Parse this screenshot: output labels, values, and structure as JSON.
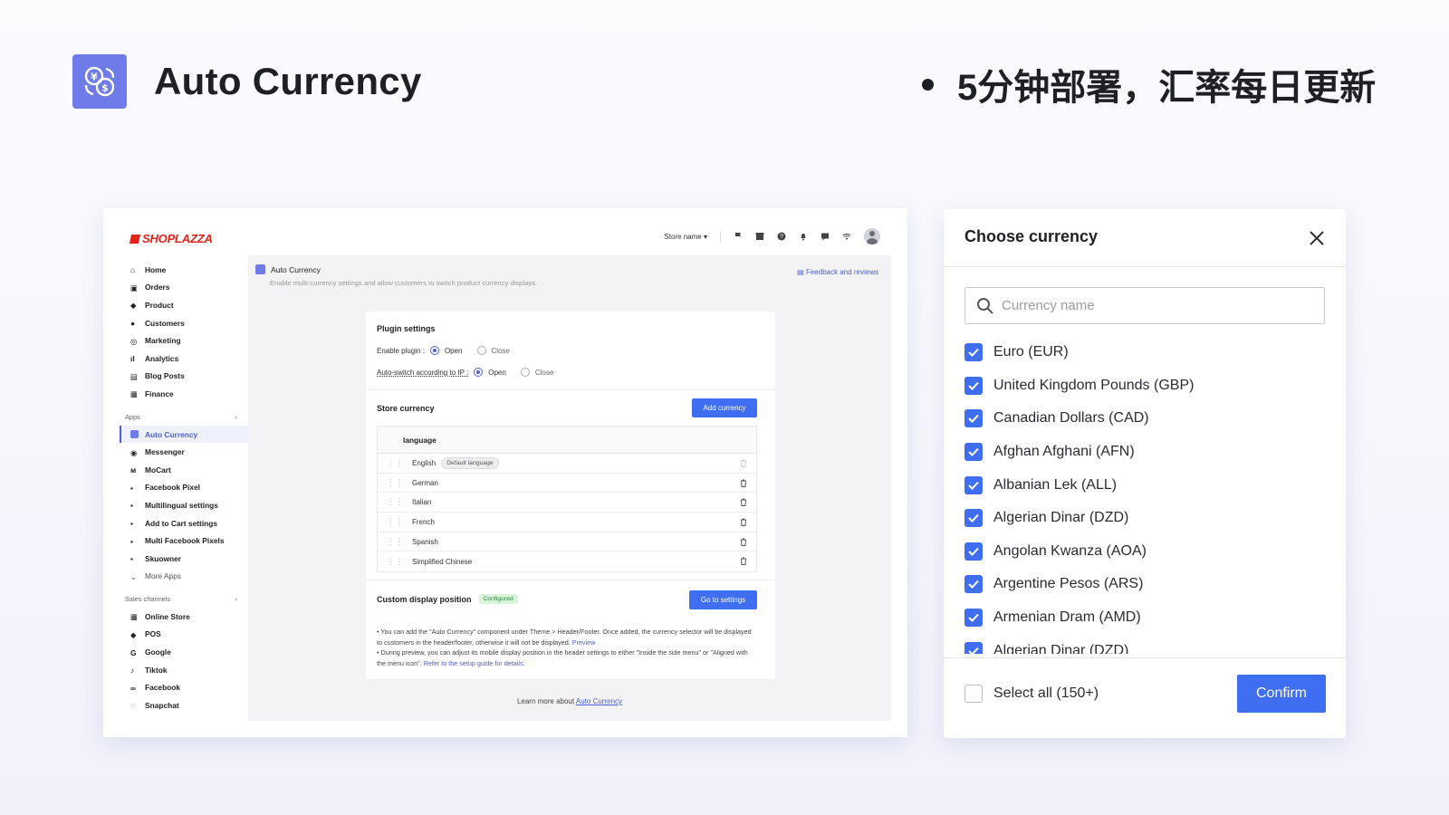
{
  "header": {
    "app_title": "Auto Currency",
    "tagline": "5分钟部署，汇率每日更新"
  },
  "admin": {
    "brand": "SHOPLAZZA",
    "store_selector": "Store name",
    "sidebar": {
      "main_items": [
        "Home",
        "Orders",
        "Product",
        "Customers",
        "Marketing",
        "Analytics",
        "Blog Posts",
        "Finance"
      ],
      "apps_label": "Apps",
      "apps_items": [
        "Auto Currency",
        "Messenger",
        "MoCart",
        "Facebook Pixel",
        "Multilingual settings",
        "Add to Cart settings",
        "Multi Facebook Pixels",
        "Skuowner"
      ],
      "more_apps": "More Apps",
      "sales_label": "Sales channels",
      "sales_items": [
        "Online Store",
        "POS",
        "Google",
        "Tiktok",
        "Facebook",
        "Snapchat"
      ]
    },
    "page": {
      "title": "Auto Currency",
      "subtitle": "Enable multi-currency settings and allow customers to switch product currency displays.",
      "feedback": "Feedback and reviews"
    },
    "plugin": {
      "title": "Plugin settings",
      "enable_label": "Enable plugin :",
      "ip_label": "Auto-switch according to IP :",
      "open": "Open",
      "close": "Close"
    },
    "store_currency": {
      "title": "Store currency",
      "add_button": "Add currency",
      "col_header": "language",
      "default_badge": "Default language",
      "rows": [
        "English",
        "German",
        "Italian",
        "French",
        "Spanish",
        "Simplified Chinese"
      ]
    },
    "display": {
      "title": "Custom display position",
      "badge": "Configured",
      "button": "Go to settings",
      "note1": "You can add the \"Auto Currency\" component under Theme > Header/Footer. Once added, the currency selector will be displayed to customers in the header/footer, otherwise it will not be displayed.",
      "note1_link": "Preview",
      "note2": "During preview, you can adjust its mobile display position in the header settings to either \"Inside the side menu\" or \"Aligned with the menu icon\".",
      "note2_link": "Refer to the setup guide for details."
    },
    "learn_more": "Learn more about",
    "learn_link": "Auto Currency"
  },
  "modal": {
    "title": "Choose currency",
    "search_placeholder": "Currency name",
    "items": [
      "Euro (EUR)",
      "United Kingdom Pounds (GBP)",
      "Canadian Dollars (CAD)",
      "Afghan Afghani (AFN)",
      "Albanian Lek (ALL)",
      "Algerian Dinar (DZD)",
      "Angolan Kwanza (AOA)",
      "Argentine Pesos (ARS)",
      "Armenian Dram (AMD)",
      "Algerian Dinar (DZD)"
    ],
    "select_all": "Select all (150+)",
    "confirm": "Confirm"
  },
  "colors": {
    "accent": "#3f6ef2",
    "brand_red": "#e2231a",
    "logo_bg": "#6e7be8"
  }
}
